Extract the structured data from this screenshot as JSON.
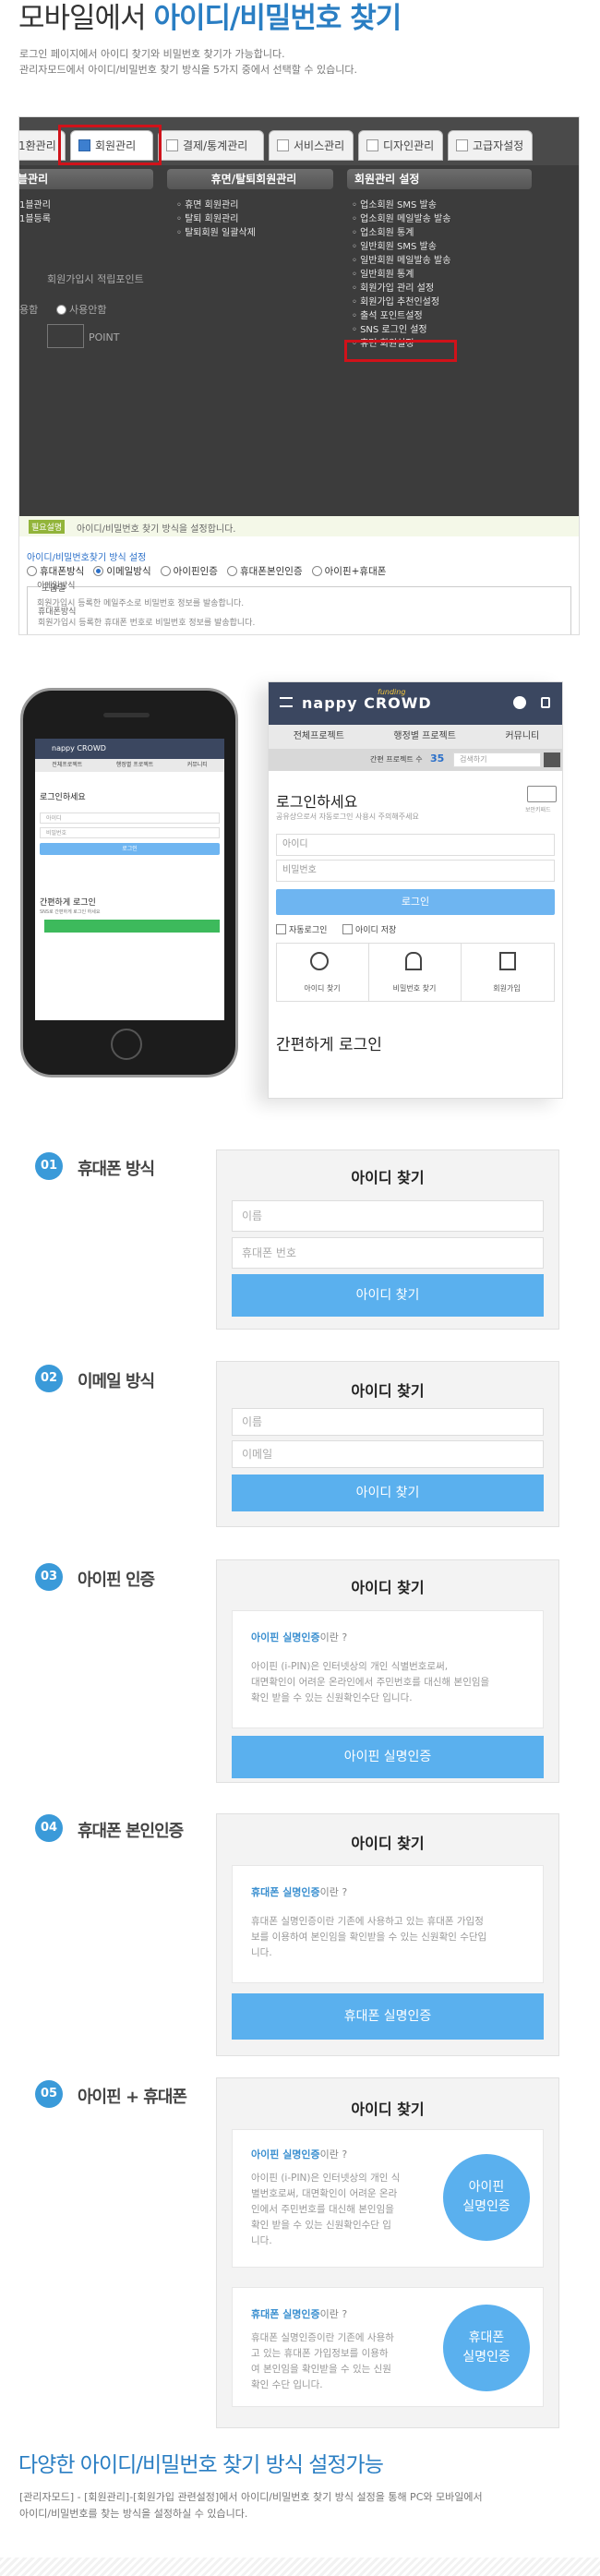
{
  "header": {
    "title_plain": "모바일에서 ",
    "title_accent": "아이디/비밀번호 찾기",
    "desc1": "로그인 페이지에서 아이디 찾기와 비밀번호 찾기가 가능합니다.",
    "desc2": "관리자모드에서 아이디/비밀번호 찾기 방식을 5가지 중에서 선택할 수 있습니다."
  },
  "admin": {
    "tabs": [
      "1환관리",
      "회원관리",
      "결제/통계관리",
      "서비스관리",
      "디자인관리",
      "고급자설정"
    ],
    "menu_heads": [
      "블관리",
      "휴면/탈퇴회원관리",
      "회원관리 설정"
    ],
    "col1": [
      "1블관리",
      "1블등록"
    ],
    "col2": [
      "휴면 회원관리",
      "탈퇴 회원관리",
      "탈퇴회원 일괄삭제"
    ],
    "col3": [
      "업소회원 SMS 발송",
      "업소회원 메일발송 발송",
      "업소회원 통계",
      "일반회원 SMS 발송",
      "일반회원 메일발송 발송",
      "일반회원 통계",
      "회원가입 관리 설정",
      "회원가입 추천인설정",
      "출석 포인트설정",
      "SNS 로그인 설정",
      "휴면 회원설정"
    ],
    "faded": [
      "회원가입시 적립포인트",
      "용함",
      "사용안함",
      "POINT"
    ],
    "notice_badge": "필요설명",
    "notice": "아이디/비밀번호 찾기 방식을 설정합니다.",
    "setting_label": "아이디/비밀번호찾기 방식 설정",
    "options": [
      "휴대폰방식",
      "이메일방식",
      "아이핀인증",
      "휴대폰본인인증",
      "아이핀+휴대폰"
    ],
    "selected_option": "이메일방식",
    "help_title": "도움말",
    "help_h1": "휴대폰방식",
    "help_t1": "회원가입시 등록한 휴대폰 번호로 비밀번호 정보를 발송합니다.",
    "help_h2": "이메일방식",
    "help_t2": "회원가입시 등록한 메일주소로 비밀번호 정보를 발송합니다."
  },
  "mobile": {
    "brand": "nappy CROWD",
    "brand_small": "funding",
    "nav": [
      "전체프로젝트",
      "행정별 프로젝트",
      "커뮤니티"
    ],
    "search_label": "간편 프로젝트 수",
    "search_count": "35",
    "search_placeholder": "검색하기",
    "login_title": "로그인하세요",
    "login_sub": "공유상으로서 자동로그인 사용시 주의해주세요",
    "keyboard_label": "보안키패드",
    "id_ph": "아이디",
    "pw_ph": "비밀번호",
    "login_btn": "로그인",
    "check1": "자동로그인",
    "check2": "아이디 저장",
    "icons": [
      "아이디 찾기",
      "비밀번호 찾기",
      "회원가입"
    ],
    "easy_login": "간편하게 로그인",
    "small_easy_sub": "SNS로 간편하게 로그인 하세요"
  },
  "features": [
    {
      "num": "01",
      "label": "휴대폰 방식",
      "panel_title": "아이디 찾기",
      "inputs": [
        "이름",
        "휴대폰 번호"
      ],
      "button": "아이디 찾기"
    },
    {
      "num": "02",
      "label": "이메일 방식",
      "panel_title": "아이디 찾기",
      "inputs": [
        "이름",
        "이메일"
      ],
      "button": "아이디 찾기"
    },
    {
      "num": "03",
      "label": "아이핀 인증",
      "panel_title": "아이디 찾기",
      "card_q": "아이핀 실명인증",
      "card_q_suffix": "이란 ?",
      "card_text": [
        "아이핀 (i-PIN)은 인터넷상의 개인 식별번호로써,",
        "대면확인이 어려운 온라인에서 주민번호를 대신해 본인임을",
        "확인 받을 수 있는 신원확인수단 입니다."
      ],
      "button": "아이핀 실명인증"
    },
    {
      "num": "04",
      "label": "휴대폰 본인인증",
      "panel_title": "아이디 찾기",
      "card_q": "휴대폰 실명인증",
      "card_q_suffix": "이란 ?",
      "card_text": [
        "휴대폰 실명인증이란 기존에 사용하고 있는 휴대폰 가입정",
        "보를 이용하여 본인임을 확인받을 수 있는 신원확인 수단입",
        "니다."
      ],
      "button": "휴대폰 실명인증"
    },
    {
      "num": "05",
      "label": "아이핀 + 휴대폰",
      "panel_title": "아이디 찾기",
      "card1_q": "아이핀 실명인증",
      "card1_q_suffix": "이란 ?",
      "card1_text": [
        "아이핀 (i-PIN)은 인터넷상의 개인 식",
        "별번호로써, 대면확인이 어려운 온라",
        "인에서 주민번호를 대신해 본인임을",
        "확인 받을 수 있는 신원확인수단 입",
        "니다."
      ],
      "circle1": [
        "아이핀",
        "실명인증"
      ],
      "card2_q": "휴대폰 실명인증",
      "card2_q_suffix": "이란 ?",
      "card2_text": [
        "휴대폰 실명인증이란 기존에 사용하",
        "고 있는 휴대폰 가입정보를 이용하",
        "여 본인임을 확인받을 수 있는 신원",
        "확인 수단 입니다."
      ],
      "circle2": [
        "휴대폰",
        "실명인증"
      ]
    }
  ],
  "footer": {
    "title": "다양한 아이디/비밀번호 찾기 방식 설정가능",
    "desc1": "[관리자모드] - [회원관리]-[회원가입 관련설정]에서 아이디/비밀번호 찾기 방식 설정을 통해 PC와 모바일에서",
    "desc2": "아이디/비밀번호를 찾는 방식을 설정하실 수 있습니다."
  },
  "colors": {
    "accent": "#2a7ec3",
    "button": "#5ab0ee",
    "badge": "#3a9ad9",
    "highlight": "#d0121a"
  }
}
